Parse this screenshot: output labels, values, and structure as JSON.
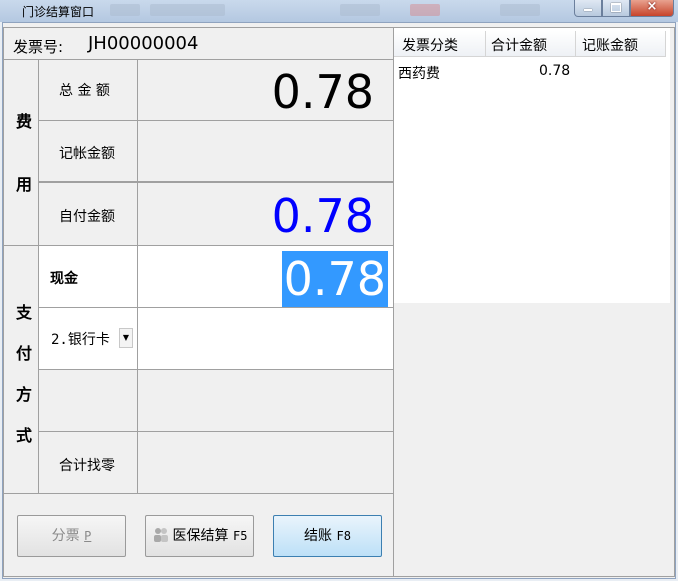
{
  "window": {
    "title": "门诊结算窗口",
    "close_glyph": "×"
  },
  "invoice": {
    "label": "发票号:",
    "number": "JH00000004"
  },
  "fee_group": {
    "chars": [
      "费",
      "用"
    ],
    "total": {
      "label": "总 金 额",
      "value": "0.78"
    },
    "account": {
      "label": "记帐金额",
      "value": ""
    },
    "self_pay": {
      "label": "自付金额",
      "value": "0.78"
    }
  },
  "payment_group": {
    "chars": [
      "支",
      "付",
      "方",
      "式"
    ],
    "cash": {
      "label": "现金",
      "value": "0.78"
    },
    "bank": {
      "select_value": "2.银行卡",
      "value": ""
    },
    "extra": {
      "label": "",
      "value": ""
    },
    "change": {
      "label": "合计找零",
      "value": ""
    }
  },
  "buttons": {
    "split": {
      "label": "分票",
      "key": "P"
    },
    "insurance": {
      "label": "医保结算",
      "key": "F5"
    },
    "settle": {
      "label": "结账",
      "key": "F8"
    }
  },
  "grid": {
    "headers": [
      "发票分类",
      "合计金额",
      "记账金额"
    ],
    "rows": [
      {
        "category": "西药费",
        "total": "0.78",
        "account": ""
      }
    ]
  },
  "colors": {
    "self_pay_value": "#0000ff",
    "cash_highlight": "#3399ff"
  }
}
